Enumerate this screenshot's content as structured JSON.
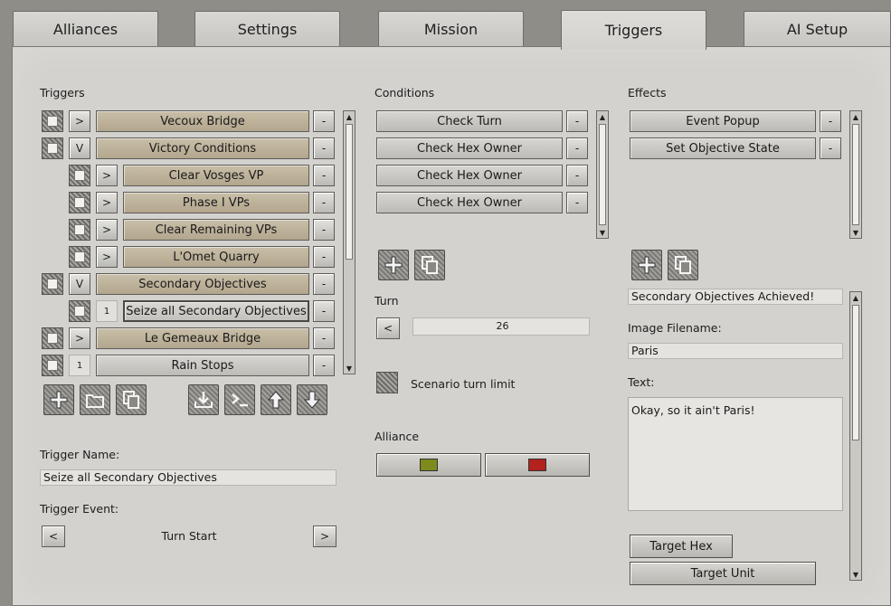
{
  "tabs": [
    {
      "label": "Alliances"
    },
    {
      "label": "Settings"
    },
    {
      "label": "Mission"
    },
    {
      "label": "Triggers"
    },
    {
      "label": "AI Setup"
    }
  ],
  "triggers_section": {
    "title": "Triggers",
    "rows": [
      {
        "toggle": ">",
        "label": "Vecoux Bridge"
      },
      {
        "toggle": "V",
        "label": "Victory Conditions"
      },
      {
        "toggle": ">",
        "label": "Clear Vosges VP"
      },
      {
        "toggle": ">",
        "label": "Phase I VPs"
      },
      {
        "toggle": ">",
        "label": "Clear Remaining VPs"
      },
      {
        "toggle": ">",
        "label": "L'Omet Quarry"
      },
      {
        "toggle": "V",
        "label": "Secondary Objectives"
      },
      {
        "toggle": "1",
        "label": "Seize all Secondary Objectives"
      },
      {
        "toggle": ">",
        "label": "Le Gemeaux Bridge"
      },
      {
        "toggle": "1",
        "label": "Rain Stops"
      }
    ],
    "minus_label": "-",
    "trigger_name_label": "Trigger Name:",
    "trigger_name_value": "Seize all Secondary Objectives",
    "trigger_event_label": "Trigger Event:",
    "trigger_event_value": "Turn Start",
    "prev": "<",
    "next": ">"
  },
  "conditions_section": {
    "title": "Conditions",
    "rows": [
      {
        "label": "Check Turn"
      },
      {
        "label": "Check Hex Owner"
      },
      {
        "label": "Check Hex Owner"
      },
      {
        "label": "Check Hex Owner"
      }
    ],
    "turn_label": "Turn",
    "turn_value": "26",
    "prev": "<",
    "scenario_limit_label": "Scenario turn limit",
    "alliance_label": "Alliance",
    "alliance_colors": [
      "#7f8a1e",
      "#b3221c"
    ]
  },
  "effects_section": {
    "title": "Effects",
    "rows": [
      {
        "label": "Event Popup"
      },
      {
        "label": "Set Objective State"
      }
    ],
    "title_value": "Secondary Objectives Achieved!",
    "image_filename_label": "Image Filename:",
    "image_filename_value": "Paris",
    "text_label": "Text:",
    "text_value": "Okay, so it ain't Paris!",
    "target_hex_label": "Target Hex",
    "target_unit_label": "Target Unit"
  }
}
